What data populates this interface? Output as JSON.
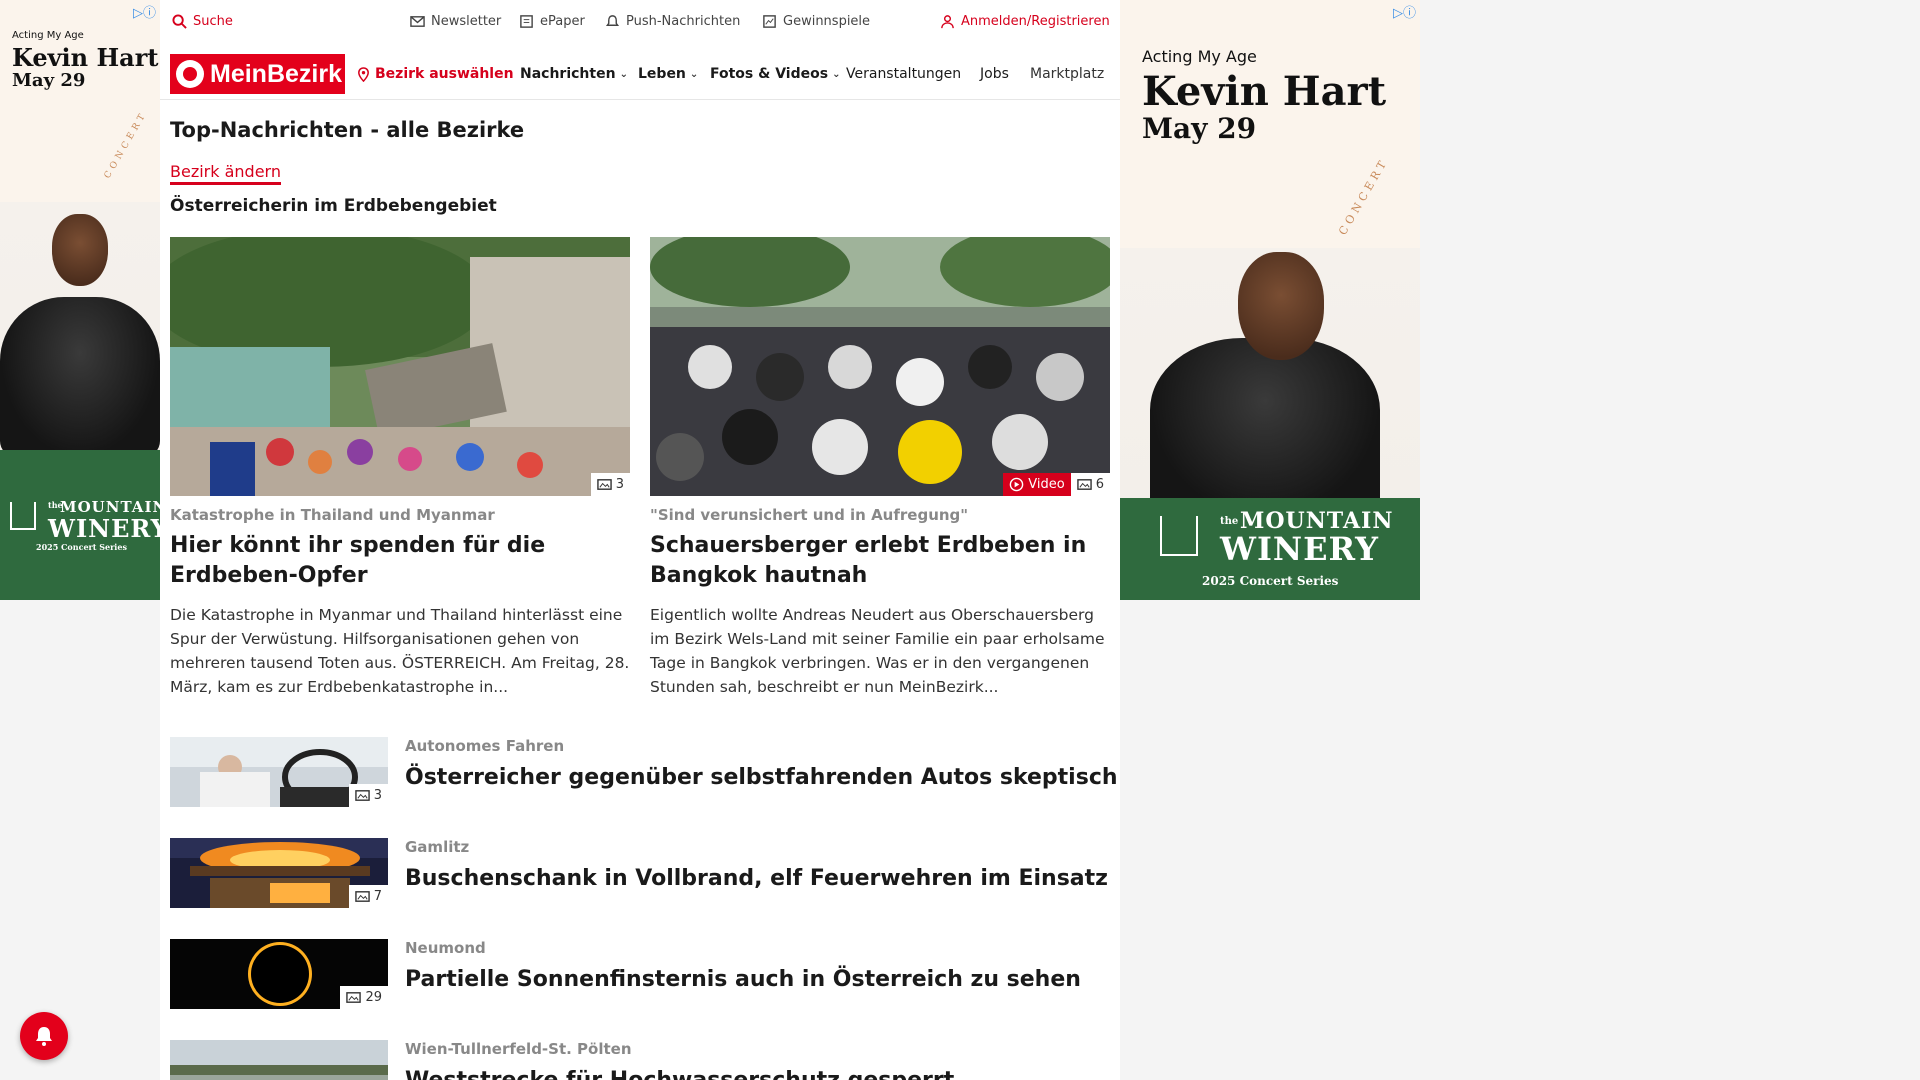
{
  "ads": {
    "left": {
      "acting": "Acting My Age",
      "name": "Kevin Hart",
      "date": "May 29",
      "concert": "CONCERT",
      "venue_the": "the",
      "venue_line1": "MOUNTAIN",
      "venue_line2": "WINERY",
      "series": "2025 Concert Series"
    },
    "right": {
      "acting": "Acting My Age",
      "name": "Kevin Hart",
      "date": "May 29",
      "concert": "CONCERT",
      "venue_the": "the",
      "venue_line1": "MOUNTAIN",
      "venue_line2": "WINERY",
      "series": "2025 Concert Series"
    }
  },
  "topbar": {
    "search": "Suche",
    "newsletter": "Newsletter",
    "epaper": "ePaper",
    "push": "Push-Nachrichten",
    "games": "Gewinnspiele",
    "login": "Anmelden/Registrieren"
  },
  "nav": {
    "logo": "MeinBezirk",
    "district": "Bezirk auswählen",
    "items": [
      "Nachrichten",
      "Leben",
      "Fotos & Videos",
      "Veranstaltungen",
      "Jobs",
      "Marktplatz"
    ]
  },
  "main": {
    "section_title": "Top-Nachrichten - alle Bezirke",
    "change_link": "Bezirk ändern",
    "subsection": "Österreicherin im Erdbebengebiet",
    "featured": [
      {
        "kicker": "Katastrophe in Thailand und Myanmar",
        "title": "Hier könnt ihr spenden für die Erdbeben-Opfer",
        "text": "Die Katastrophe in Myanmar und Thailand hinterlässt eine Spur der Verwüstung. Hilfsorganisationen gehen von mehreren tausend Toten aus.  ÖSTERREICH. Am Freitag, 28. März, kam es zur Erdbebenkatastrophe in...",
        "photo_count": "3"
      },
      {
        "kicker": "\"Sind verunsichert und in Aufregung\"",
        "title": "Schauersberger erlebt Erdbeben in Bangkok hautnah",
        "text": "Eigentlich wollte Andreas Neudert aus Oberschauersberg im Bezirk Wels-Land mit seiner Familie ein paar erholsame Tage in Bangkok verbringen. Was er in den vergangenen Stunden sah, beschreibt er nun MeinBezirk...",
        "video_label": "Video",
        "photo_count": "6"
      }
    ],
    "list": [
      {
        "kicker": "Autonomes Fahren",
        "title": "Österreicher gegenüber selbstfahrenden Autos skeptisch",
        "photo_count": "3"
      },
      {
        "kicker": "Gamlitz",
        "title": "Buschenschank in Vollbrand, elf Feuerwehren im Einsatz",
        "photo_count": "7"
      },
      {
        "kicker": "Neumond",
        "title": "Partielle Sonnenfinsternis auch in Österreich zu sehen",
        "photo_count": "29"
      },
      {
        "kicker": "Wien-Tullnerfeld-St. Pölten",
        "title": "Weststrecke für Hochwasserschutz gesperrt",
        "photo_count": ""
      }
    ]
  },
  "colors": {
    "brand_red": "#e3001b",
    "winery_green": "#2f6a3e"
  },
  "icons": [
    "adchoices-icon",
    "search-icon",
    "mail-icon",
    "epaper-icon",
    "bell-icon",
    "gift-icon",
    "user-icon",
    "location-pin-icon",
    "chevron-down-icon",
    "camera-icon",
    "play-icon"
  ]
}
